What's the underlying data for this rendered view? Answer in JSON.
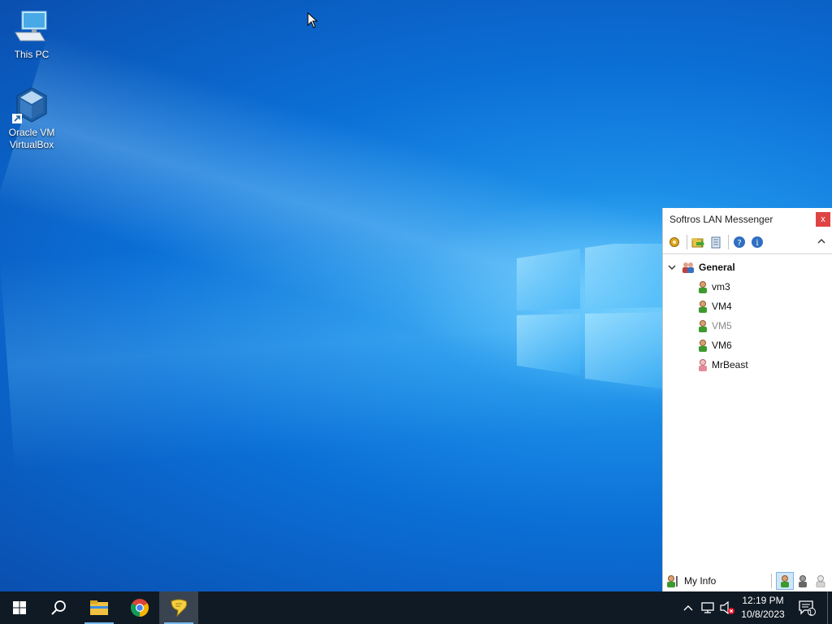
{
  "desktop": {
    "icons": [
      {
        "label": "This PC",
        "icon": "computer-icon"
      },
      {
        "label": "Oracle VM VirtualBox",
        "icon": "virtualbox-icon"
      }
    ]
  },
  "messenger": {
    "title": "Softros LAN Messenger",
    "close_label": "x",
    "toolbar": [
      "settings-icon",
      "open-folder-icon",
      "history-icon",
      "help-icon",
      "info-icon"
    ],
    "group": {
      "name": "General",
      "expanded": true
    },
    "users": [
      {
        "name": "vm3",
        "status": "online"
      },
      {
        "name": "VM4",
        "status": "online"
      },
      {
        "name": "VM5",
        "status": "offline"
      },
      {
        "name": "VM6",
        "status": "online"
      },
      {
        "name": "MrBeast",
        "status": "away"
      }
    ],
    "my_info_label": "My Info"
  },
  "taskbar": {
    "apps": [
      "start-icon",
      "search-icon",
      "file-explorer-icon",
      "chrome-icon",
      "softros-messenger-icon"
    ],
    "clock": {
      "time": "12:19 PM",
      "date": "10/8/2023"
    },
    "notification_count": "1"
  },
  "colors": {
    "taskbar_bg": "#101a24",
    "close_red": "#e04343",
    "online_green": "#3c9a2e",
    "away_pink": "#e58a9a"
  }
}
